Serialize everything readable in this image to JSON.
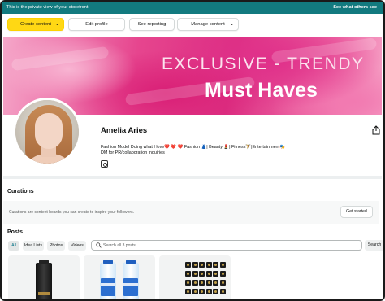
{
  "topbar": {
    "notice": "This is the private view of your storefront",
    "link": "See what others see"
  },
  "actions": {
    "create": "Create content",
    "edit": "Edit profile",
    "reporting": "See reporting",
    "manage": "Manage content"
  },
  "banner": {
    "line1": "EXCLUSIVE - TRENDY",
    "line2": "Must Haves"
  },
  "profile": {
    "name": "Amelia Aries",
    "bio_line1": "Fashion Model Doing what I love❤️ ❤️ ❤️  Fashion 👗| Beauty 💄| Fitness🏋️|Entertainment🎭",
    "bio_line2": "DM for PR/collaboration inquiries"
  },
  "curations": {
    "title": "Curations",
    "description": "Curations are content boards you can create to inspire your followers.",
    "button": "Get started"
  },
  "posts": {
    "title": "Posts",
    "filters": [
      "All",
      "Idea Lists",
      "Photos",
      "Videos"
    ],
    "search_placeholder": "Search all 3 posts",
    "search_button": "Search"
  },
  "colors": {
    "topbar": "#127a7f",
    "primary_button": "#ffd814",
    "banner_pink": "#dc2f82"
  }
}
